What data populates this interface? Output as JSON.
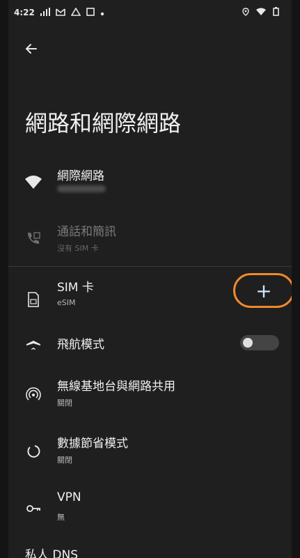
{
  "status": {
    "time": "4:22"
  },
  "page": {
    "title": "網路和網際網路"
  },
  "items": {
    "internet": {
      "label": "網際網路"
    },
    "calls_sms": {
      "label": "通話和簡訊",
      "sub": "沒有 SIM 卡"
    },
    "sim": {
      "label": "SIM 卡",
      "sub": "eSIM",
      "add_symbol": "+"
    },
    "airplane": {
      "label": "飛航模式",
      "toggle_on": false
    },
    "hotspot": {
      "label": "無線基地台與網路共用",
      "sub": "關閉"
    },
    "data_saver": {
      "label": "數據節省模式",
      "sub": "關閉"
    },
    "vpn": {
      "label": "VPN",
      "sub": "無"
    },
    "private_dns": {
      "label": "私人 DNS"
    }
  },
  "colors": {
    "accent": "#f08a2b",
    "background": "#1f1f1f"
  },
  "icons": [
    "back-arrow-icon",
    "wifi-icon",
    "call-sms-icon",
    "sim-card-icon",
    "add-icon",
    "airplane-icon",
    "hotspot-icon",
    "data-saver-icon",
    "vpn-key-icon"
  ]
}
